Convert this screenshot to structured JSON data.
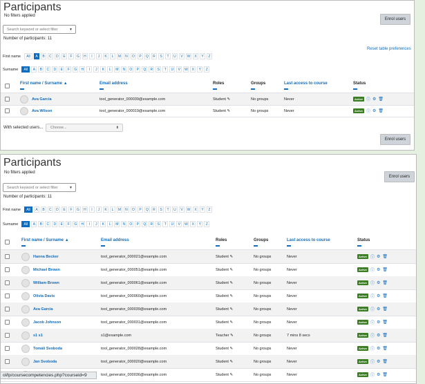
{
  "shared": {
    "title": "Participants",
    "filters": "No filters applied",
    "search_placeholder": "Search keyword or select filter",
    "enrol_label": "Enrol users",
    "first_name_label": "First name",
    "surname_label": "Surname",
    "letters": [
      "All",
      "A",
      "B",
      "C",
      "D",
      "E",
      "F",
      "G",
      "H",
      "I",
      "J",
      "K",
      "L",
      "M",
      "N",
      "O",
      "P",
      "Q",
      "R",
      "S",
      "T",
      "U",
      "V",
      "W",
      "X",
      "Y",
      "Z"
    ],
    "columns": {
      "name": "First name / Surname",
      "email": "Email address",
      "roles": "Roles",
      "groups": "Groups",
      "access": "Last access to course",
      "status": "Status"
    },
    "status_badge": "Active",
    "colors": {
      "link": "#0f6cbf",
      "active": "#3a7d22",
      "button": "#ced4da"
    }
  },
  "panel1": {
    "count": "Number of participants: 11",
    "reset_label": "Reset table preferences",
    "first_selected": "A",
    "surname_selected": "All",
    "rows": [
      {
        "name": "Ava Garcia",
        "email": "tool_generator_000039@example.com",
        "role": "Student",
        "groups": "No groups",
        "access": "Never"
      },
      {
        "name": "Ava Wilson",
        "email": "tool_generator_000019@example.com",
        "role": "Student",
        "groups": "No groups",
        "access": "Never"
      }
    ],
    "with_selected": "With selected users...",
    "choose": "Choose..."
  },
  "panel2": {
    "count": "Number of participants: 11",
    "first_selected": "All",
    "surname_selected": "All",
    "rows": [
      {
        "name": "Hanna Becker",
        "email": "tool_generator_000021@example.com",
        "role": "Student",
        "groups": "No groups",
        "access": "Never"
      },
      {
        "name": "Michael Brown",
        "email": "tool_generator_000051@example.com",
        "role": "Student",
        "groups": "No groups",
        "access": "Never"
      },
      {
        "name": "William Brown",
        "email": "tool_generator_000061@example.com",
        "role": "Student",
        "groups": "No groups",
        "access": "Never"
      },
      {
        "name": "Olivia Davis",
        "email": "tool_generator_000060@example.com",
        "role": "Student",
        "groups": "No groups",
        "access": "Never"
      },
      {
        "name": "Ava Garcia",
        "email": "tool_generator_000039@example.com",
        "role": "Student",
        "groups": "No groups",
        "access": "Never"
      },
      {
        "name": "Jacob Johnson",
        "email": "tool_generator_000031@example.com",
        "role": "Student",
        "groups": "No groups",
        "access": "Never"
      },
      {
        "name": "s1 s1",
        "email": "s1@example.com",
        "role": "Teacher",
        "groups": "No groups",
        "access": "7 mins 8 secs"
      },
      {
        "name": "Tomáš Svoboda",
        "email": "tool_generator_000028@example.com",
        "role": "Student",
        "groups": "No groups",
        "access": "Never"
      },
      {
        "name": "Jan Svoboda",
        "email": "tool_generator_000020@example.com",
        "role": "Student",
        "groups": "No groups",
        "access": "Never"
      },
      {
        "name": "",
        "email": "tool_generator_000036@example.com",
        "role": "Student",
        "groups": "No groups",
        "access": "Never"
      }
    ]
  },
  "statusbar": "ol/lp/coursecompetencies.php?courseid=9"
}
